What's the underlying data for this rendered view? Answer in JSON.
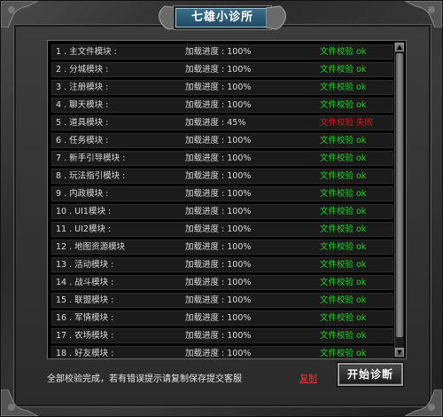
{
  "window": {
    "title": "七雄小诊所"
  },
  "colors": {
    "ok": "#22d12a",
    "fail": "#e01818",
    "title_plate": "#2b5c77"
  },
  "rows": [
    {
      "name": "1 . 主文件模块 :",
      "progress": "加载进度 : 100%",
      "status": "文件校验 ok",
      "state": "ok"
    },
    {
      "name": "2 . 分城模块 :",
      "progress": "加载进度 : 100%",
      "status": "文件校验 ok",
      "state": "ok"
    },
    {
      "name": "3 . 注册模块 :",
      "progress": "加载进度 : 100%",
      "status": "文件校验 ok",
      "state": "ok"
    },
    {
      "name": "4 . 聊天模块 :",
      "progress": "加载进度 : 100%",
      "status": "文件校验 ok",
      "state": "ok"
    },
    {
      "name": "5 . 道具模块 :",
      "progress": "加载进度 : 45%",
      "status": "文件校验 失败",
      "state": "fail"
    },
    {
      "name": "6 . 任务模块 :",
      "progress": "加载进度 : 100%",
      "status": "文件校验 ok",
      "state": "ok"
    },
    {
      "name": "7 . 新手引导模块 :",
      "progress": "加载进度 : 100%",
      "status": "文件校验 ok",
      "state": "ok"
    },
    {
      "name": "8 . 玩法指引模块 :",
      "progress": "加载进度 : 100%",
      "status": "文件校验 ok",
      "state": "ok"
    },
    {
      "name": "9 . 内政模块 :",
      "progress": "加载进度 : 100%",
      "status": "文件校验 ok",
      "state": "ok"
    },
    {
      "name": "10 . UI1模块 :",
      "progress": "加载进度 : 100%",
      "status": "文件校验 ok",
      "state": "ok"
    },
    {
      "name": "11 . UI2模块 :",
      "progress": "加载进度 : 100%",
      "status": "文件校验 ok",
      "state": "ok"
    },
    {
      "name": "12 . 地图资源模块",
      "progress": "加载进度 : 100%",
      "status": "文件校验 ok",
      "state": "ok"
    },
    {
      "name": "13 . 活动模块 :",
      "progress": "加载进度 : 100%",
      "status": "文件校验 ok",
      "state": "ok"
    },
    {
      "name": "14 . 战斗模块 :",
      "progress": "加载进度 : 100%",
      "status": "文件校验 ok",
      "state": "ok"
    },
    {
      "name": "15 . 联盟模块 :",
      "progress": "加载进度 : 100%",
      "status": "文件校验 ok",
      "state": "ok"
    },
    {
      "name": "16 . 军情模块 :",
      "progress": "加载进度 : 100%",
      "status": "文件校验 ok",
      "state": "ok"
    },
    {
      "name": "17 . 农场模块 :",
      "progress": "加载进度 : 100%",
      "status": "文件校验 ok",
      "state": "ok"
    },
    {
      "name": "18 . 好友模块 :",
      "progress": "加载进度 : 100%",
      "status": "文件校验 ok",
      "state": "ok"
    }
  ],
  "footer": {
    "message": "全部校验完成，若有错误提示请复制保存提交客服",
    "copy_label": "复制",
    "start_button": "开始诊断"
  },
  "icons": {
    "scroll_up": "triangle-up",
    "scroll_down": "triangle-down"
  }
}
